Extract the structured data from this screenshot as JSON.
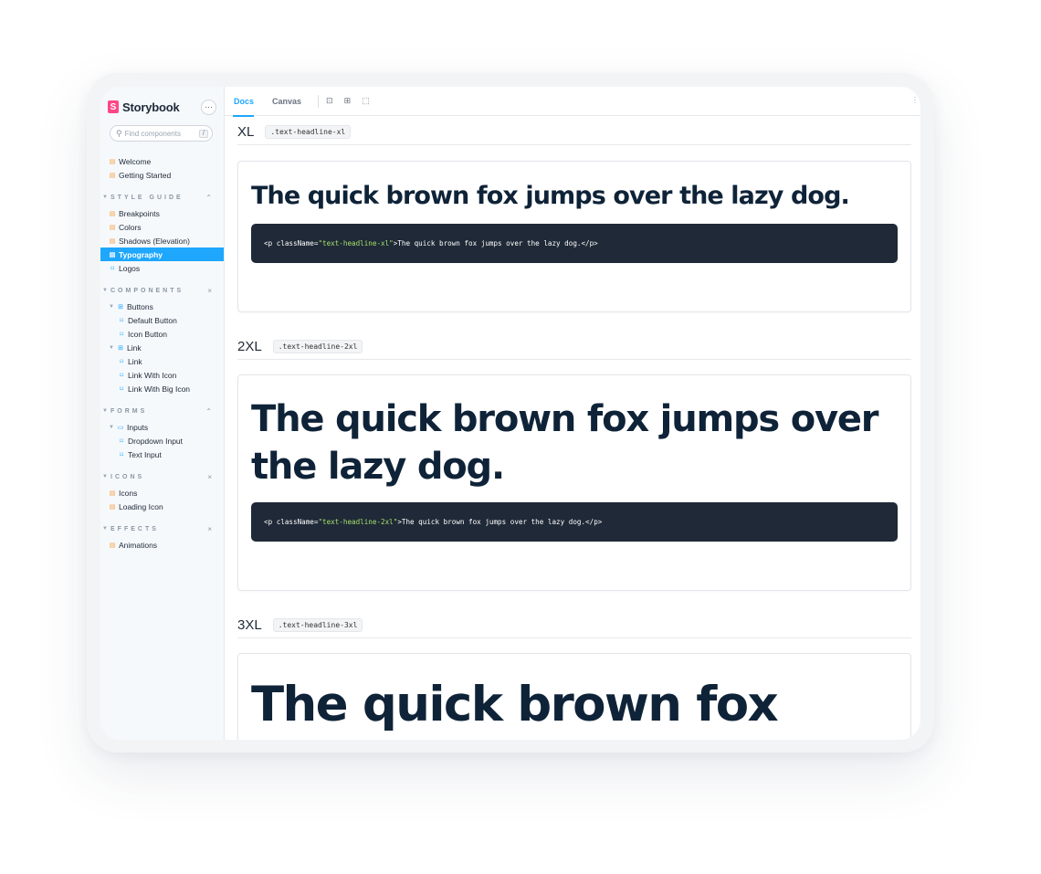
{
  "brand": {
    "name": "Storybook",
    "menu_label": "···"
  },
  "search": {
    "placeholder": "Find components",
    "shortcut": "/"
  },
  "nav": {
    "top": [
      {
        "label": "Welcome",
        "icon": "doc-icon"
      },
      {
        "label": "Getting Started",
        "icon": "doc-icon"
      }
    ],
    "sections": [
      {
        "title": "STYLE GUIDE",
        "toggle": "⌃",
        "items": [
          {
            "label": "Breakpoints",
            "icon": "doc-icon"
          },
          {
            "label": "Colors",
            "icon": "doc-icon"
          },
          {
            "label": "Shadows (Elevation)",
            "icon": "doc-icon"
          },
          {
            "label": "Typography",
            "icon": "doc-icon",
            "active": true
          },
          {
            "label": "Logos",
            "icon": "story-icon"
          }
        ]
      },
      {
        "title": "COMPONENTS",
        "toggle": "×",
        "items": [
          {
            "label": "Buttons",
            "icon": "component-icon",
            "level": 0
          },
          {
            "label": "Default Button",
            "icon": "story-icon",
            "level": 1
          },
          {
            "label": "Icon Button",
            "icon": "story-icon",
            "level": 1
          },
          {
            "label": "Link",
            "icon": "component-icon",
            "level": 0
          },
          {
            "label": "Link",
            "icon": "story-icon",
            "level": 1
          },
          {
            "label": "Link With Icon",
            "icon": "story-icon",
            "level": 1
          },
          {
            "label": "Link With Big Icon",
            "icon": "story-icon",
            "level": 1
          }
        ]
      },
      {
        "title": "FORMS",
        "toggle": "⌃",
        "items": [
          {
            "label": "Inputs",
            "icon": "folder-icon",
            "level": 0
          },
          {
            "label": "Dropdown Input",
            "icon": "story-icon",
            "level": 1
          },
          {
            "label": "Text Input",
            "icon": "story-icon",
            "level": 1
          }
        ]
      },
      {
        "title": "ICONS",
        "toggle": "×",
        "items": [
          {
            "label": "Icons",
            "icon": "doc-icon"
          },
          {
            "label": "Loading Icon",
            "icon": "doc-icon"
          }
        ]
      },
      {
        "title": "EFFECTS",
        "toggle": "×",
        "items": [
          {
            "label": "Animations",
            "icon": "doc-icon"
          }
        ]
      }
    ]
  },
  "toolbar": {
    "tab_docs": "Docs",
    "tab_canvas": "Canvas"
  },
  "sample_text": "The quick brown fox jumps over the lazy dog.",
  "sections": [
    {
      "size": "XL",
      "class_name": ".text-headline-xl",
      "code_prefix": "<p className=",
      "code_class": "\"text-headline-xl\"",
      "code_suffix": ">The quick brown fox jumps over the lazy dog.</p>"
    },
    {
      "size": "2XL",
      "class_name": ".text-headline-2xl",
      "code_prefix": "<p className=",
      "code_class": "\"text-headline-2xl\"",
      "code_suffix": ">The quick brown fox jumps over the lazy dog.</p>"
    },
    {
      "size": "3XL",
      "class_name": ".text-headline-3xl",
      "sample_visible": "The quick brown fox"
    }
  ],
  "colors": {
    "accent": "#1ea7fd",
    "brand": "#ff4785",
    "code_bg": "#1f2937",
    "code_string": "#a5e06b",
    "heading": "#0f2338"
  }
}
